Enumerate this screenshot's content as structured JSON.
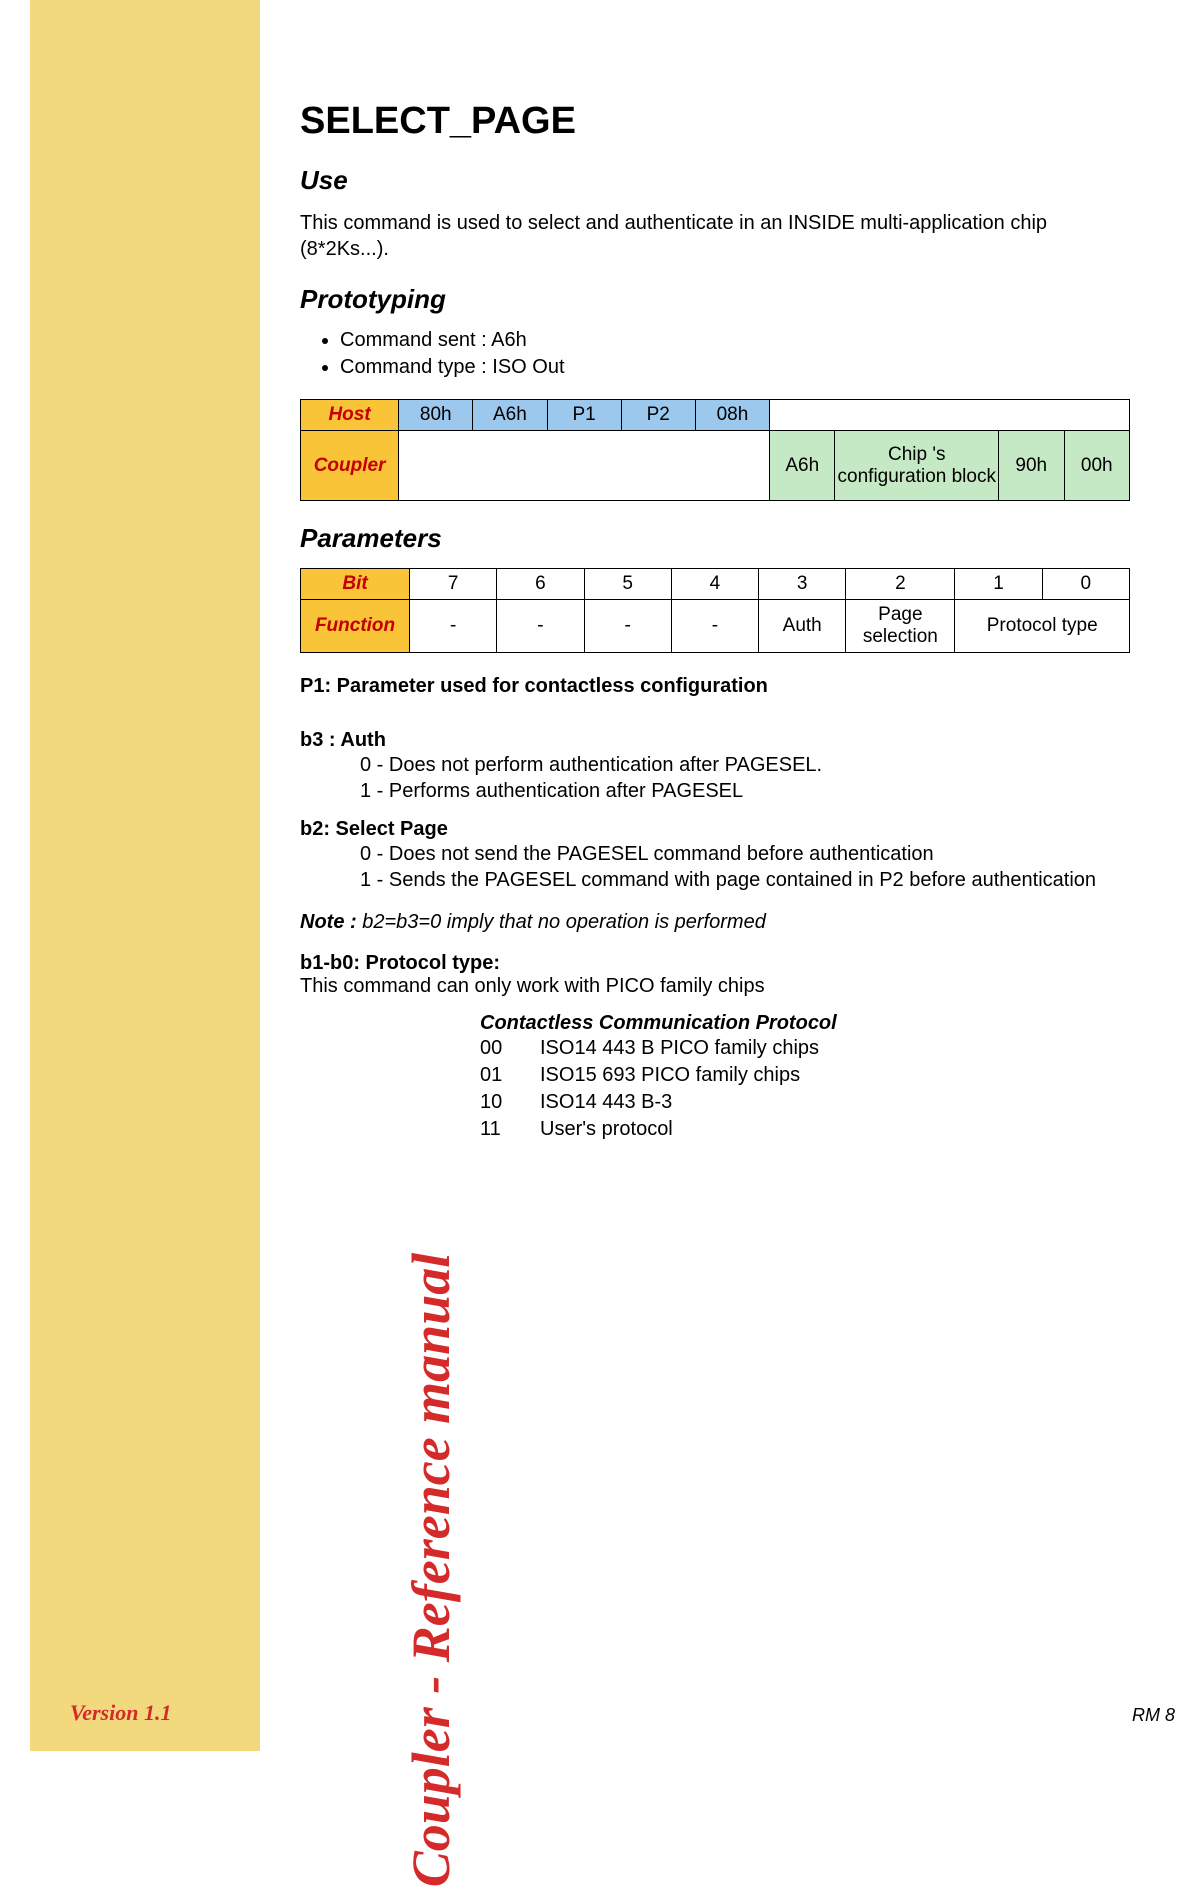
{
  "sidebar": {
    "title": "Coupler - Reference manual",
    "version": "Version 1.1"
  },
  "page": {
    "title": "SELECT_PAGE",
    "footer": "RM 8"
  },
  "use": {
    "heading": "Use",
    "text": "This command is used to select and authenticate in an INSIDE multi-application chip (8*2Ks...)."
  },
  "prototyping": {
    "heading": "Prototyping",
    "items": [
      "Command sent : A6h",
      "Command type : ISO Out"
    ],
    "row1label": "Host",
    "row1cells": [
      "80h",
      "A6h",
      "P1",
      "P2",
      "08h"
    ],
    "row2label": "Coupler",
    "row2cells": [
      "A6h",
      "Chip 's configuration block",
      "90h",
      "00h"
    ]
  },
  "parameters": {
    "heading": "Parameters",
    "bit_header": "Bit",
    "bits": [
      "7",
      "6",
      "5",
      "4",
      "3",
      "2",
      "1",
      "0"
    ],
    "func_header": "Function",
    "funcs": [
      "-",
      "-",
      "-",
      "-",
      "Auth",
      "Page selection",
      "Protocol type"
    ],
    "caption": "P1: Parameter used for contactless configuration",
    "b3": {
      "title": "b3 : Auth",
      "l0": "0 - Does not perform authentication after PAGESEL.",
      "l1": "1 - Performs authentication after PAGESEL"
    },
    "b2": {
      "title": "b2: Select Page",
      "l0": "0 - Does not send the PAGESEL command before authentication",
      "l1": "1 - Sends the PAGESEL command with page contained in P2 before authentication"
    },
    "note_label": "Note :",
    "note_text": " b2=b3=0 imply that no operation is performed",
    "b10": {
      "title": "b1-b0: Protocol type:",
      "text": "This command can only work with PICO family chips"
    },
    "protocols": {
      "heading": "Contactless Communication Protocol",
      "rows": [
        {
          "code": "00",
          "desc": "ISO14 443 B PICO family chips"
        },
        {
          "code": "01",
          "desc": "ISO15 693 PICO family chips"
        },
        {
          "code": "10",
          "desc": "ISO14 443 B-3"
        },
        {
          "code": "11",
          "desc": "User's protocol"
        }
      ]
    }
  }
}
